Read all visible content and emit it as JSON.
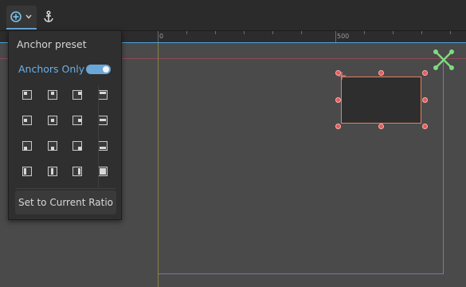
{
  "toolbar": {
    "preset_icon": "anchor-preset-icon",
    "dropdown_icon": "chevron-down-icon",
    "anchor_icon": "anchor-icon"
  },
  "ruler": {
    "labels": [
      "0",
      "500"
    ]
  },
  "popup": {
    "title": "Anchor preset",
    "anchors_only_label": "Anchors Only",
    "anchors_only_enabled": true,
    "set_ratio_label": "Set to Current Ratio"
  },
  "colors": {
    "accent": "#6aa6d8",
    "selection": "#e0835c",
    "handle": "#e65a5a",
    "anchor_marker": "#7ddc7d"
  }
}
